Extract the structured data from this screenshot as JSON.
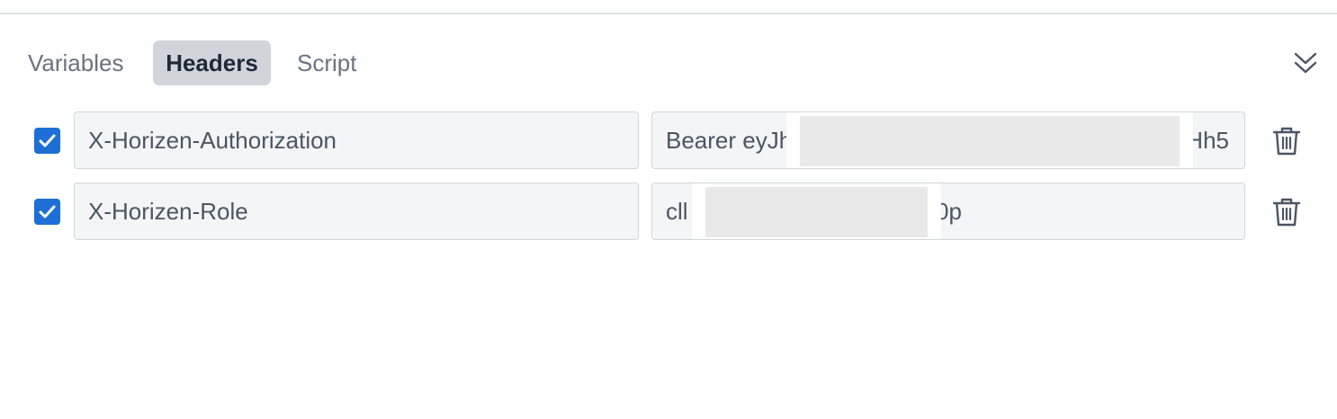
{
  "tabs": [
    {
      "label": "Variables",
      "active": false
    },
    {
      "label": "Headers",
      "active": true
    },
    {
      "label": "Script",
      "active": false
    }
  ],
  "headers": [
    {
      "enabled": true,
      "key": "X-Horizen-Authorization",
      "value_start": "Bearer eyJh",
      "value_end": "Hh5",
      "redacted": true
    },
    {
      "enabled": true,
      "key": "X-Horizen-Role",
      "value_start": "cll",
      "value_end": "0p",
      "redacted": true
    }
  ],
  "colors": {
    "accent": "#1d6fd6",
    "active_tab_bg": "#d1d5db",
    "field_bg": "#f4f5f7"
  },
  "icons": {
    "collapse": "chevrons-down-icon",
    "checkbox": "checkmark-icon",
    "delete": "trash-icon"
  }
}
